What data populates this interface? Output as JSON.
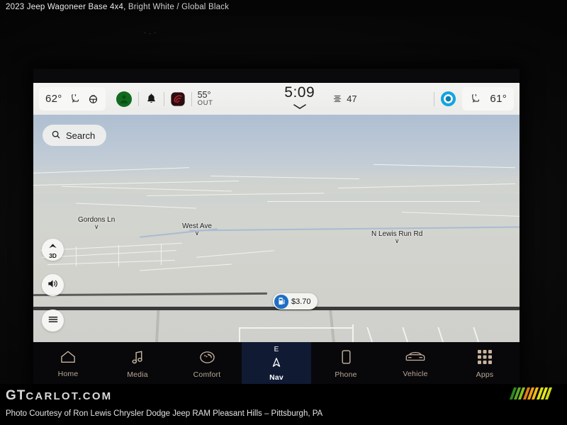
{
  "caption": {
    "vehicle": "2023 Jeep Wagoneer Base 4x4,",
    "colors": "Bright White / Global Black"
  },
  "statusbar": {
    "left_temp": "62°",
    "seat_icon": "heated-seat-icon",
    "steering_icon": "heated-steering-wheel-icon",
    "driver_icon": "driver-profile-icon",
    "bell_icon": "notification-bell-icon",
    "radio_icon": "satellite-radio-icon",
    "outside_temp_value": "55°",
    "outside_temp_label": "OUT",
    "clock": "5:09",
    "chevron_icon": "chevron-down-icon",
    "fan_icon": "fan-speed-icon",
    "fan_value": "47",
    "sync_icon": "auto-sync-icon",
    "passenger_seat_icon": "heated-seat-icon",
    "right_temp": "61°"
  },
  "map": {
    "search_placeholder": "Search",
    "search_icon": "search-icon",
    "labels": [
      {
        "text": "Gordons Ln"
      },
      {
        "text": "West Ave"
      },
      {
        "text": "N Lewis Run Rd"
      }
    ],
    "controls": [
      {
        "name": "view-mode-3d",
        "label": "3D",
        "icon": "north-arrow-icon"
      },
      {
        "name": "map-volume",
        "label": "",
        "icon": "speaker-icon"
      },
      {
        "name": "map-menu",
        "label": "",
        "icon": "hamburger-menu-icon"
      }
    ],
    "poi": {
      "icon": "fuel-pump-icon",
      "price": "$3.70"
    },
    "vehicle_marker_icon": "vehicle-position-arrow-icon"
  },
  "bottomnav": {
    "items": [
      {
        "label": "Home",
        "icon": "home-icon",
        "active": false
      },
      {
        "label": "Media",
        "icon": "music-note-icon",
        "active": false
      },
      {
        "label": "Comfort",
        "icon": "comfort-seat-icon",
        "active": false
      },
      {
        "label": "Nav",
        "icon": "compass-arrow-icon",
        "active": true,
        "compass": "E"
      },
      {
        "label": "Phone",
        "icon": "phone-icon",
        "active": false
      },
      {
        "label": "Vehicle",
        "icon": "car-front-icon",
        "active": false
      },
      {
        "label": "Apps",
        "icon": "grid-apps-icon",
        "active": false
      }
    ]
  },
  "footer": {
    "logo_primary": "GT",
    "logo_secondary": "CARLOT.COM",
    "credit": "Photo Courtesy of Ron Lewis Chrysler Dodge Jeep RAM Pleasant Hills – Pittsburgh, PA",
    "stripe_colors": [
      "#2f8a1e",
      "#5aa82a",
      "#8dc021",
      "#e07d14",
      "#f0a018",
      "#f5b81a",
      "#d8e018",
      "#e8e820",
      "#c8d818"
    ]
  }
}
